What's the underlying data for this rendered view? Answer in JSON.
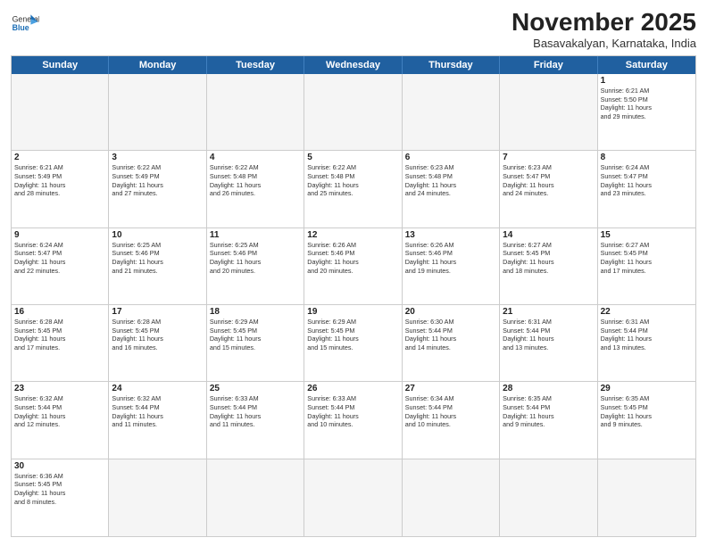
{
  "header": {
    "logo_general": "General",
    "logo_blue": "Blue",
    "month_title": "November 2025",
    "subtitle": "Basavakalyan, Karnataka, India"
  },
  "day_headers": [
    "Sunday",
    "Monday",
    "Tuesday",
    "Wednesday",
    "Thursday",
    "Friday",
    "Saturday"
  ],
  "weeks": [
    [
      {
        "day": "",
        "info": ""
      },
      {
        "day": "",
        "info": ""
      },
      {
        "day": "",
        "info": ""
      },
      {
        "day": "",
        "info": ""
      },
      {
        "day": "",
        "info": ""
      },
      {
        "day": "",
        "info": ""
      },
      {
        "day": "1",
        "info": "Sunrise: 6:21 AM\nSunset: 5:50 PM\nDaylight: 11 hours\nand 29 minutes."
      }
    ],
    [
      {
        "day": "2",
        "info": "Sunrise: 6:21 AM\nSunset: 5:49 PM\nDaylight: 11 hours\nand 28 minutes."
      },
      {
        "day": "3",
        "info": "Sunrise: 6:22 AM\nSunset: 5:49 PM\nDaylight: 11 hours\nand 27 minutes."
      },
      {
        "day": "4",
        "info": "Sunrise: 6:22 AM\nSunset: 5:48 PM\nDaylight: 11 hours\nand 26 minutes."
      },
      {
        "day": "5",
        "info": "Sunrise: 6:22 AM\nSunset: 5:48 PM\nDaylight: 11 hours\nand 25 minutes."
      },
      {
        "day": "6",
        "info": "Sunrise: 6:23 AM\nSunset: 5:48 PM\nDaylight: 11 hours\nand 24 minutes."
      },
      {
        "day": "7",
        "info": "Sunrise: 6:23 AM\nSunset: 5:47 PM\nDaylight: 11 hours\nand 24 minutes."
      },
      {
        "day": "8",
        "info": "Sunrise: 6:24 AM\nSunset: 5:47 PM\nDaylight: 11 hours\nand 23 minutes."
      }
    ],
    [
      {
        "day": "9",
        "info": "Sunrise: 6:24 AM\nSunset: 5:47 PM\nDaylight: 11 hours\nand 22 minutes."
      },
      {
        "day": "10",
        "info": "Sunrise: 6:25 AM\nSunset: 5:46 PM\nDaylight: 11 hours\nand 21 minutes."
      },
      {
        "day": "11",
        "info": "Sunrise: 6:25 AM\nSunset: 5:46 PM\nDaylight: 11 hours\nand 20 minutes."
      },
      {
        "day": "12",
        "info": "Sunrise: 6:26 AM\nSunset: 5:46 PM\nDaylight: 11 hours\nand 20 minutes."
      },
      {
        "day": "13",
        "info": "Sunrise: 6:26 AM\nSunset: 5:46 PM\nDaylight: 11 hours\nand 19 minutes."
      },
      {
        "day": "14",
        "info": "Sunrise: 6:27 AM\nSunset: 5:45 PM\nDaylight: 11 hours\nand 18 minutes."
      },
      {
        "day": "15",
        "info": "Sunrise: 6:27 AM\nSunset: 5:45 PM\nDaylight: 11 hours\nand 17 minutes."
      }
    ],
    [
      {
        "day": "16",
        "info": "Sunrise: 6:28 AM\nSunset: 5:45 PM\nDaylight: 11 hours\nand 17 minutes."
      },
      {
        "day": "17",
        "info": "Sunrise: 6:28 AM\nSunset: 5:45 PM\nDaylight: 11 hours\nand 16 minutes."
      },
      {
        "day": "18",
        "info": "Sunrise: 6:29 AM\nSunset: 5:45 PM\nDaylight: 11 hours\nand 15 minutes."
      },
      {
        "day": "19",
        "info": "Sunrise: 6:29 AM\nSunset: 5:45 PM\nDaylight: 11 hours\nand 15 minutes."
      },
      {
        "day": "20",
        "info": "Sunrise: 6:30 AM\nSunset: 5:44 PM\nDaylight: 11 hours\nand 14 minutes."
      },
      {
        "day": "21",
        "info": "Sunrise: 6:31 AM\nSunset: 5:44 PM\nDaylight: 11 hours\nand 13 minutes."
      },
      {
        "day": "22",
        "info": "Sunrise: 6:31 AM\nSunset: 5:44 PM\nDaylight: 11 hours\nand 13 minutes."
      }
    ],
    [
      {
        "day": "23",
        "info": "Sunrise: 6:32 AM\nSunset: 5:44 PM\nDaylight: 11 hours\nand 12 minutes."
      },
      {
        "day": "24",
        "info": "Sunrise: 6:32 AM\nSunset: 5:44 PM\nDaylight: 11 hours\nand 11 minutes."
      },
      {
        "day": "25",
        "info": "Sunrise: 6:33 AM\nSunset: 5:44 PM\nDaylight: 11 hours\nand 11 minutes."
      },
      {
        "day": "26",
        "info": "Sunrise: 6:33 AM\nSunset: 5:44 PM\nDaylight: 11 hours\nand 10 minutes."
      },
      {
        "day": "27",
        "info": "Sunrise: 6:34 AM\nSunset: 5:44 PM\nDaylight: 11 hours\nand 10 minutes."
      },
      {
        "day": "28",
        "info": "Sunrise: 6:35 AM\nSunset: 5:44 PM\nDaylight: 11 hours\nand 9 minutes."
      },
      {
        "day": "29",
        "info": "Sunrise: 6:35 AM\nSunset: 5:45 PM\nDaylight: 11 hours\nand 9 minutes."
      }
    ],
    [
      {
        "day": "30",
        "info": "Sunrise: 6:36 AM\nSunset: 5:45 PM\nDaylight: 11 hours\nand 8 minutes."
      },
      {
        "day": "",
        "info": ""
      },
      {
        "day": "",
        "info": ""
      },
      {
        "day": "",
        "info": ""
      },
      {
        "day": "",
        "info": ""
      },
      {
        "day": "",
        "info": ""
      },
      {
        "day": "",
        "info": ""
      }
    ]
  ]
}
